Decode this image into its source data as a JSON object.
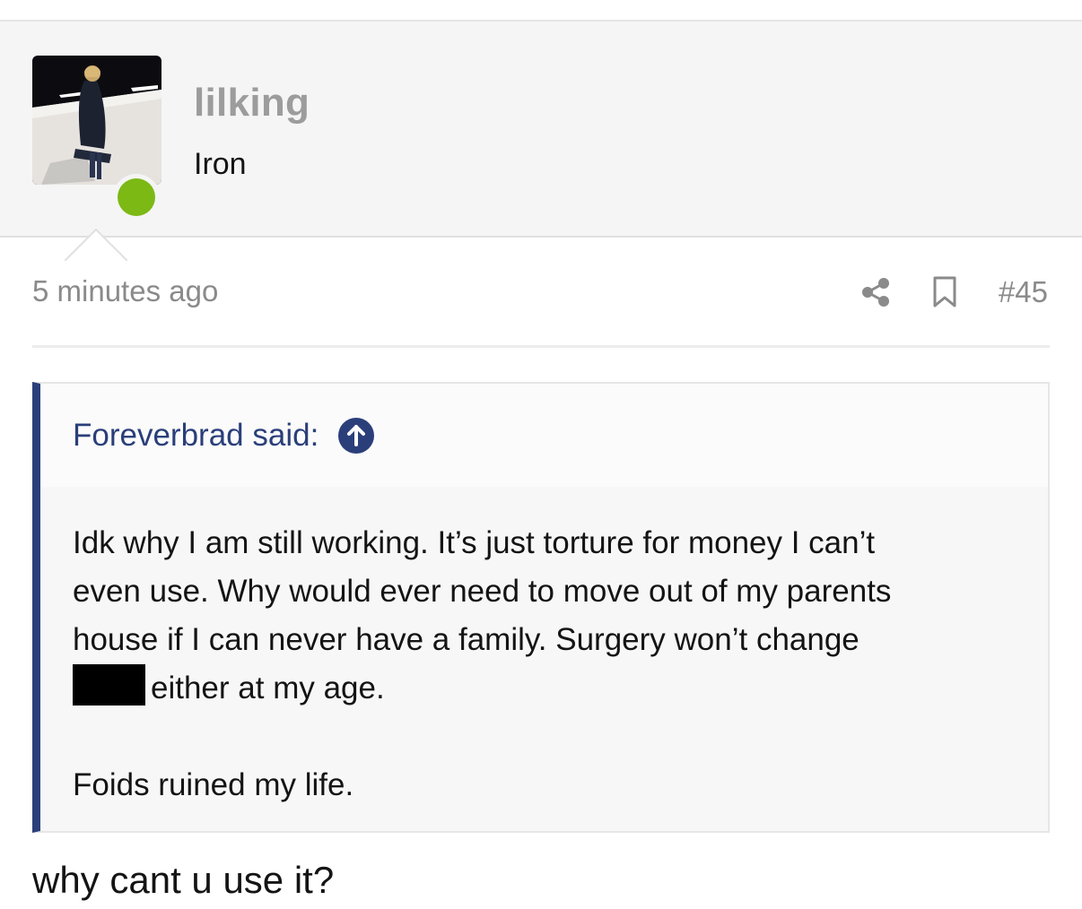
{
  "user": {
    "username": "lilking",
    "title": "Iron",
    "online": true,
    "online_color": "#7cb915"
  },
  "post": {
    "time": "5 minutes ago",
    "number": "#45",
    "icons": [
      "share-icon",
      "bookmark-icon"
    ]
  },
  "quote": {
    "attribution": "Foreverbrad said:",
    "arrow_icon": "arrow-up-icon",
    "line1": "Idk why I am still working. It’s just torture for money I can’t",
    "line2": "even use. Why would ever need to move out of my parents",
    "line3": "house if I can never have a family. Surgery won’t change",
    "line4": "either at my age.",
    "paragraph2": "Foids ruined my life.",
    "accent_color": "#2a3f7a"
  },
  "reply": {
    "text": "why cant u use it?"
  }
}
